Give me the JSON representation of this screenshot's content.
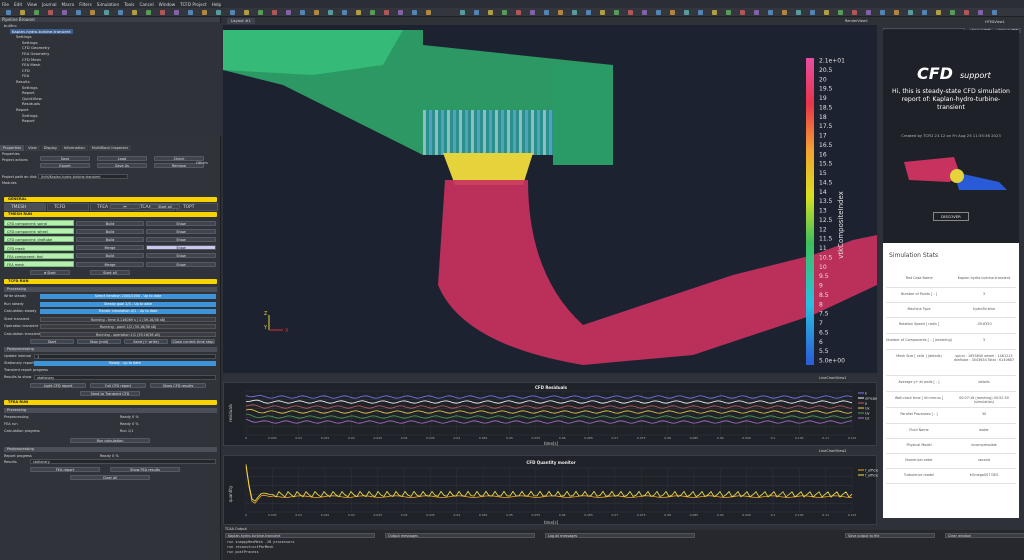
{
  "menu": [
    "File",
    "Edit",
    "View",
    "Journal",
    "Macro",
    "Filters",
    "Simulation",
    "Tools",
    "Cancel",
    "Window",
    "TCFD Project",
    "Help"
  ],
  "left": {
    "pipeline_title": "Pipeline Browser",
    "tree": [
      {
        "label": "builtin:",
        "indent": 0
      },
      {
        "label": "Kaplan-hydro-turbine-transient",
        "indent": 1,
        "selected": true
      },
      {
        "label": "Settings",
        "indent": 2
      },
      {
        "label": "Settings",
        "indent": 3
      },
      {
        "label": "CFD Geometry",
        "indent": 3
      },
      {
        "label": "FEA Geometry",
        "indent": 3
      },
      {
        "label": "CFD Mesh",
        "indent": 3
      },
      {
        "label": "FEA Mesh",
        "indent": 3
      },
      {
        "label": "CFD",
        "indent": 3
      },
      {
        "label": "FEA",
        "indent": 3
      },
      {
        "label": "Results",
        "indent": 2
      },
      {
        "label": "Settings",
        "indent": 3
      },
      {
        "label": "Report",
        "indent": 3
      },
      {
        "label": "QuickView",
        "indent": 3
      },
      {
        "label": "Residuals",
        "indent": 3
      },
      {
        "label": "Report",
        "indent": 2
      },
      {
        "label": "Settings",
        "indent": 3
      },
      {
        "label": "Report",
        "indent": 3
      }
    ],
    "tabs": [
      "Properties",
      "View",
      "Display",
      "Information",
      "MultiBlock Inspector"
    ],
    "properties_label": "Properties",
    "project_actions": "Project actions",
    "actions": [
      "Save",
      "Load",
      "Check",
      "Export",
      "Save As",
      "Remove"
    ],
    "others": "Others",
    "project_path_label": "Project path on disk",
    "project_path": "/tcfd/Kaplan-hydro-turbine-transient",
    "modules_label": "Modules",
    "modules": [
      "TMESH",
      "TCFD",
      "TFEA",
      "TCAA",
      "TOPT"
    ],
    "general": "GENERAL",
    "stop_label": "Start all",
    "tmesh_run": "TMESH RUN",
    "mesh_rows": [
      {
        "name": "CFD component: spiral",
        "a": "Build",
        "b": "Show"
      },
      {
        "name": "CFD component: wheel",
        "a": "Build",
        "b": "Show"
      },
      {
        "name": "CFD component: draftube",
        "a": "Build",
        "b": "Show"
      },
      {
        "name": "CFD mesh",
        "a": "Merge",
        "b": "Show"
      },
      {
        "name": "FEA component: tbd",
        "a": "Build",
        "b": "Show"
      },
      {
        "name": "FEA mesh",
        "a": "Merge",
        "b": "Show"
      }
    ],
    "start_all": "Start all",
    "tcfd_run": "TCFD RUN",
    "processing": "Processing",
    "tcfd_rows": [
      {
        "k": "Write steady",
        "v": "Select iteration 2000/2000 - Up to date"
      },
      {
        "k": "Run steady",
        "v": "Steady goal 2/3 - Up to date"
      },
      {
        "k": "Calculation steady",
        "v": "Transit: simulation 4/1 - Up to date"
      },
      {
        "k": "Start transient",
        "v": "Running - time 0.116089 s / 1 (39.16/36 sB)"
      },
      {
        "k": "Operation transient",
        "v": "Running - point 1/2 (39.16/36 sB)"
      },
      {
        "k": "Calculation transient",
        "v": "Running - operation 1/1 (39.16/36 sB)"
      }
    ],
    "run_btns": [
      "Start",
      "Stop (mid)",
      "Send (+ write)",
      "Close current time step"
    ],
    "postprocessing": "Postprocessing",
    "post_rows": [
      {
        "k": "Update interval",
        "v": "1"
      },
      {
        "k": "Stationary report progress",
        "v": "Ready - up to date"
      },
      {
        "k": "Transient report progress",
        "v": ""
      },
      {
        "k": "Results to show",
        "v": "stationary"
      }
    ],
    "post_btns": [
      "Light CFD report",
      "Full CFD report",
      "Show CFD results",
      "Send to Transient CFD"
    ],
    "tfea_run": "TFEA RUN",
    "tfea_rows": [
      {
        "k": "Preprocessing",
        "v": "Ready 0 %"
      },
      {
        "k": "FEA run",
        "v": "Ready 0 %"
      },
      {
        "k": "Calculation progress",
        "v": "Run 1/1"
      }
    ],
    "tfea_btn": "Run calculation",
    "report_progress": "Report progress",
    "report_progress_val": "Ready 0 %",
    "results_label": "Results",
    "results_val": "stationary",
    "tfea_post_btns": [
      "FEA report",
      "Show FEA results"
    ],
    "clear": "Clear all"
  },
  "view": {
    "tab": "Layout #1",
    "render_label": "RenderView1",
    "colorbar_title": "vtkCompositeIndex",
    "colorbar_ticks": [
      "2.1e+01",
      "20.5",
      "20",
      "19.5",
      "19",
      "18.5",
      "18",
      "17.5",
      "17",
      "16.5",
      "16",
      "15.5",
      "15",
      "14.5",
      "14",
      "13.5",
      "13",
      "12.5",
      "12",
      "11.5",
      "11",
      "10.5",
      "10",
      "9.5",
      "9",
      "8.5",
      "8",
      "7.5",
      "7",
      "6.5",
      "6",
      "5.5",
      "5.0e+00"
    ],
    "axes": {
      "z": "Z",
      "y": "Y",
      "x": "X"
    }
  },
  "residuals": {
    "title": "CFD Residuals",
    "header": "LineChartView1",
    "ylabel": "residuals",
    "xlabel": "time[s]",
    "legend": [
      "k",
      "omega",
      "p",
      "Ux",
      "Uy",
      "Uz"
    ],
    "xticks": [
      "0",
      "0.005",
      "0.01",
      "0.015",
      "0.02",
      "0.025",
      "0.03",
      "0.035",
      "0.04",
      "0.045",
      "0.05",
      "0.055",
      "0.06",
      "0.065",
      "0.07",
      "0.075",
      "0.08",
      "0.085",
      "0.09",
      "0.095",
      "0.1",
      "0.105",
      "0.11",
      "0.115"
    ],
    "colors": [
      "#7b7bff",
      "#ffffff",
      "#c06060",
      "#f0d050",
      "#50a050",
      "#b070d0"
    ]
  },
  "monitor": {
    "title": "CFD Quantity monitor",
    "header": "LineChartView2",
    "ylabel": "quantity",
    "xlabel": "time[s]",
    "legend": [
      "f_efficiency-avg(-)",
      "f_efficiency(-)"
    ],
    "colors": [
      "#f5a623",
      "#f7e24a"
    ],
    "xticks": [
      "0",
      "0.005",
      "0.01",
      "0.015",
      "0.02",
      "0.025",
      "0.03",
      "0.035",
      "0.04",
      "0.045",
      "0.05",
      "0.055",
      "0.06",
      "0.065",
      "0.07",
      "0.075",
      "0.08",
      "0.085",
      "0.09",
      "0.095",
      "0.1",
      "0.105",
      "0.11",
      "0.115"
    ]
  },
  "right": {
    "header": "HTMLView1",
    "url": "file:///tcfd/Kaplan-hydro-turbine-transient/report.html",
    "btns": [
      "Save as PDF",
      "Open as PDF"
    ],
    "logo_main": "CFD",
    "logo_sub": "support",
    "hi": "Hi, this is steady-state CFD simulation report of: Kaplan-hydro-turbine-transient",
    "created": "Created by TCFD 23.12 on Fri Aug 25 11:35:36 2023",
    "discover": "DISCOVER",
    "stats_title": "Simulation Stats",
    "stats": [
      {
        "k": "Test Case Name",
        "v": "Kaplan-hydro-turbine-transient"
      },
      {
        "k": "Number of Points [ - ]",
        "v": "3"
      },
      {
        "k": "Machine Type",
        "v": "hydroTurbine"
      },
      {
        "k": "Rotation Speed [ rad/s ]",
        "v": "-39.6350"
      },
      {
        "k": "Number of Components [ - ] (meshing)",
        "v": "3"
      },
      {
        "k": "Mesh Size [ cells ] (details)",
        "v": "spiral : 1655840 wheel : 1461213 draftube : 3043634 Total : 6140687"
      },
      {
        "k": "Average y+ at walls [ - ]",
        "v": "details"
      },
      {
        "k": "Wall-clock time [ hh:mm:ss ]",
        "v": "00:07:16 (meshing) 00:52:50 (simulation)"
      },
      {
        "k": "Parallel Processes [ - ]",
        "v": "30"
      },
      {
        "k": "Fluid Name",
        "v": "water"
      },
      {
        "k": "Physical Model",
        "v": "incompressible"
      },
      {
        "k": "Numerical order",
        "v": "second"
      },
      {
        "k": "Turbulence model",
        "v": "kOmegaSST DES"
      }
    ]
  },
  "bottom": {
    "title": "TCAA Output",
    "fields": [
      "Kaplan-hydro-turbine-transient",
      "Output messages",
      "Log all messages",
      "Save output to file",
      "Clear window"
    ],
    "lines": [
      "run snappyHexMesh -28 processors",
      "run reconstructParMesh",
      "run postProcess"
    ]
  }
}
